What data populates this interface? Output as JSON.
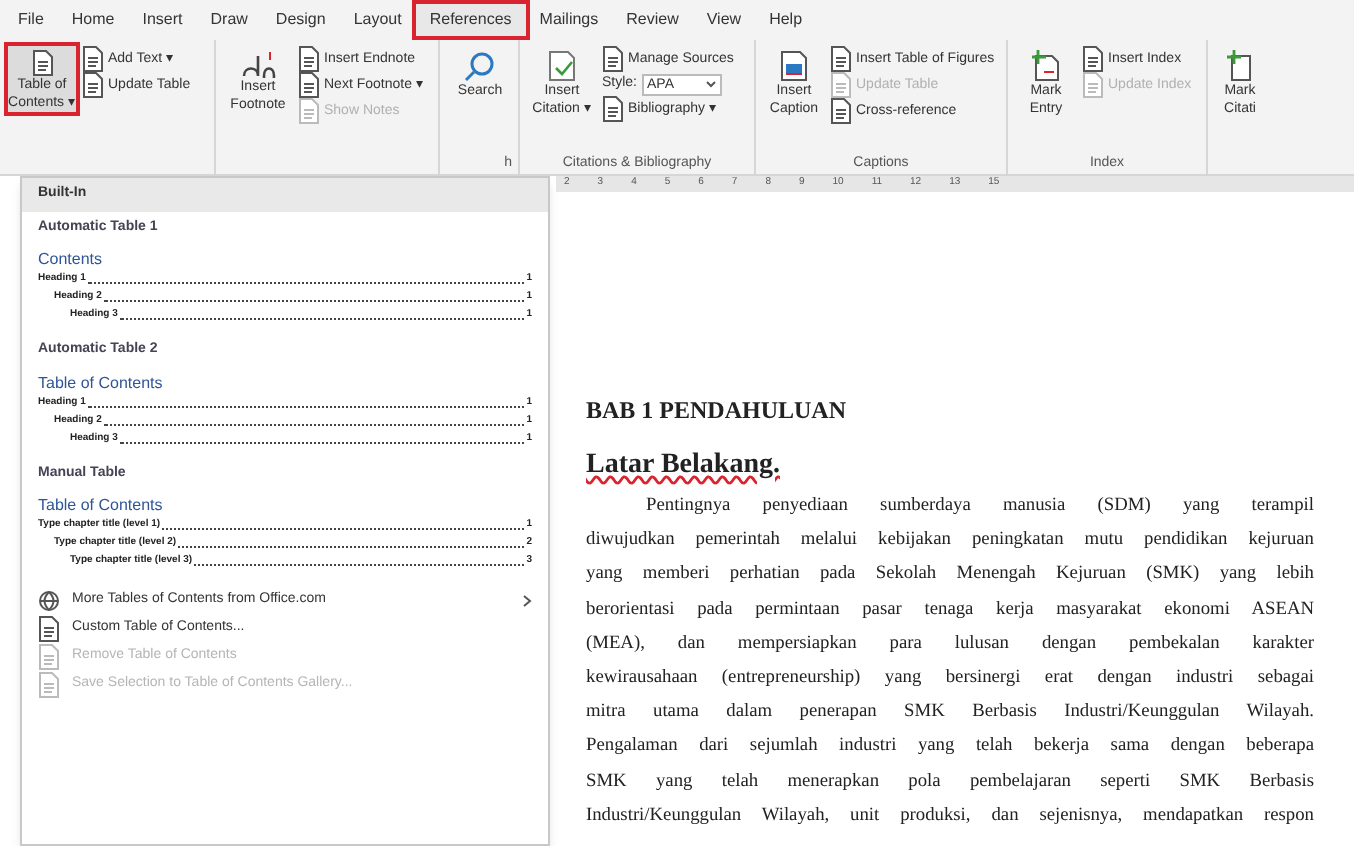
{
  "tabs": [
    {
      "label": "File",
      "selected": false
    },
    {
      "label": "Home",
      "selected": false
    },
    {
      "label": "Insert",
      "selected": false
    },
    {
      "label": "Draw",
      "selected": false
    },
    {
      "label": "Design",
      "selected": false
    },
    {
      "label": "Layout",
      "selected": false
    },
    {
      "label": "References",
      "selected": true
    },
    {
      "label": "Mailings",
      "selected": false
    },
    {
      "label": "Review",
      "selected": false
    },
    {
      "label": "View",
      "selected": false
    },
    {
      "label": "Help",
      "selected": false
    }
  ],
  "ribbon": {
    "toc": {
      "big": {
        "label": "Table of\nContents ▾",
        "highlighted": true
      },
      "small": [
        {
          "label": "Add Text ▾",
          "disabled": false
        },
        {
          "label": "Update Table",
          "disabled": false
        }
      ]
    },
    "footnotes": {
      "big": {
        "label": "Insert\nFootnote"
      },
      "small": [
        {
          "label": "Insert Endnote",
          "disabled": false
        },
        {
          "label": "Next Footnote ▾",
          "disabled": false
        },
        {
          "label": "Show Notes",
          "disabled": true
        }
      ]
    },
    "research": {
      "big": {
        "label": "Search"
      },
      "group_label": "h"
    },
    "citations": {
      "big": {
        "label": "Insert\nCitation ▾"
      },
      "manage": "Manage Sources",
      "style_label": "Style:",
      "style_value": "APA",
      "bibliography": "Bibliography ▾",
      "group_label": "Citations & Bibliography"
    },
    "captions": {
      "big": {
        "label": "Insert\nCaption"
      },
      "small": [
        {
          "label": "Insert Table of Figures",
          "disabled": false
        },
        {
          "label": "Update Table",
          "disabled": true
        },
        {
          "label": "Cross-reference",
          "disabled": false
        }
      ],
      "group_label": "Captions"
    },
    "index": {
      "big": {
        "label": "Mark\nEntry"
      },
      "small": [
        {
          "label": "Insert Index",
          "disabled": false
        },
        {
          "label": "Update Index",
          "disabled": true
        }
      ],
      "group_label": "Index"
    },
    "cut": {
      "big": {
        "label": "Mark\nCitati"
      }
    }
  },
  "ruler": [
    "2",
    "3",
    "4",
    "5",
    "6",
    "7",
    "8",
    "9",
    "10",
    "11",
    "12",
    "13",
    "15"
  ],
  "dropdown": {
    "header": "Built-In",
    "sections": [
      {
        "title": "Automatic Table 1",
        "toc_title": "Contents",
        "entries": [
          {
            "text": "Heading 1",
            "page": "1"
          },
          {
            "text": "Heading 2",
            "page": "1"
          },
          {
            "text": "Heading 3",
            "page": "1"
          }
        ]
      },
      {
        "title": "Automatic Table 2",
        "toc_title": "Table of Contents",
        "entries": [
          {
            "text": "Heading 1",
            "page": "1"
          },
          {
            "text": "Heading 2",
            "page": "1"
          },
          {
            "text": "Heading 3",
            "page": "1"
          }
        ]
      },
      {
        "title": "Manual Table",
        "toc_title": "Table of Contents",
        "entries": [
          {
            "text": "Type chapter title (level 1)",
            "page": "1"
          },
          {
            "text": "Type chapter title (level 2)",
            "page": "2"
          },
          {
            "text": "Type chapter title (level 3)",
            "page": "3"
          }
        ]
      }
    ],
    "menu": [
      {
        "kind": "web",
        "label": "More Tables of Contents from Office.com",
        "disabled": false,
        "submenu": true
      },
      {
        "kind": "doc",
        "label": "Custom Table of Contents...",
        "disabled": false,
        "submenu": false
      },
      {
        "kind": "doc",
        "label": "Remove Table of Contents",
        "disabled": true,
        "submenu": false
      },
      {
        "kind": "doc",
        "label": "Save Selection to Table of Contents Gallery...",
        "disabled": true,
        "submenu": false
      }
    ]
  },
  "document": {
    "chapter": "BAB 1 PENDAHULUAN",
    "heading": "Latar Belakang.",
    "lines": [
      "Pentingnya penyediaan sumberdaya manusia (SDM) yang terampil",
      "diwujudkan pemerintah melalui kebijakan peningkatan mutu pendidikan kejuruan",
      "yang memberi perhatian pada Sekolah Menengah Kejuruan (SMK) yang lebih",
      "berorientasi pada permintaan pasar tenaga kerja masyarakat ekonomi ASEAN",
      "(MEA), dan mempersiapkan para lulusan dengan pembekalan karakter",
      "kewirausahaan (entrepreneurship) yang bersinergi erat dengan industri sebagai",
      "mitra utama dalam penerapan SMK Berbasis Industri/Keunggulan Wilayah.",
      "Pengalaman dari sejumlah industri yang telah bekerja sama dengan beberapa",
      "SMK yang telah menerapkan pola pembelajaran seperti SMK Berbasis",
      "Industri/Keunggulan Wilayah, unit produksi, dan sejenisnya, mendapatkan respon"
    ]
  }
}
